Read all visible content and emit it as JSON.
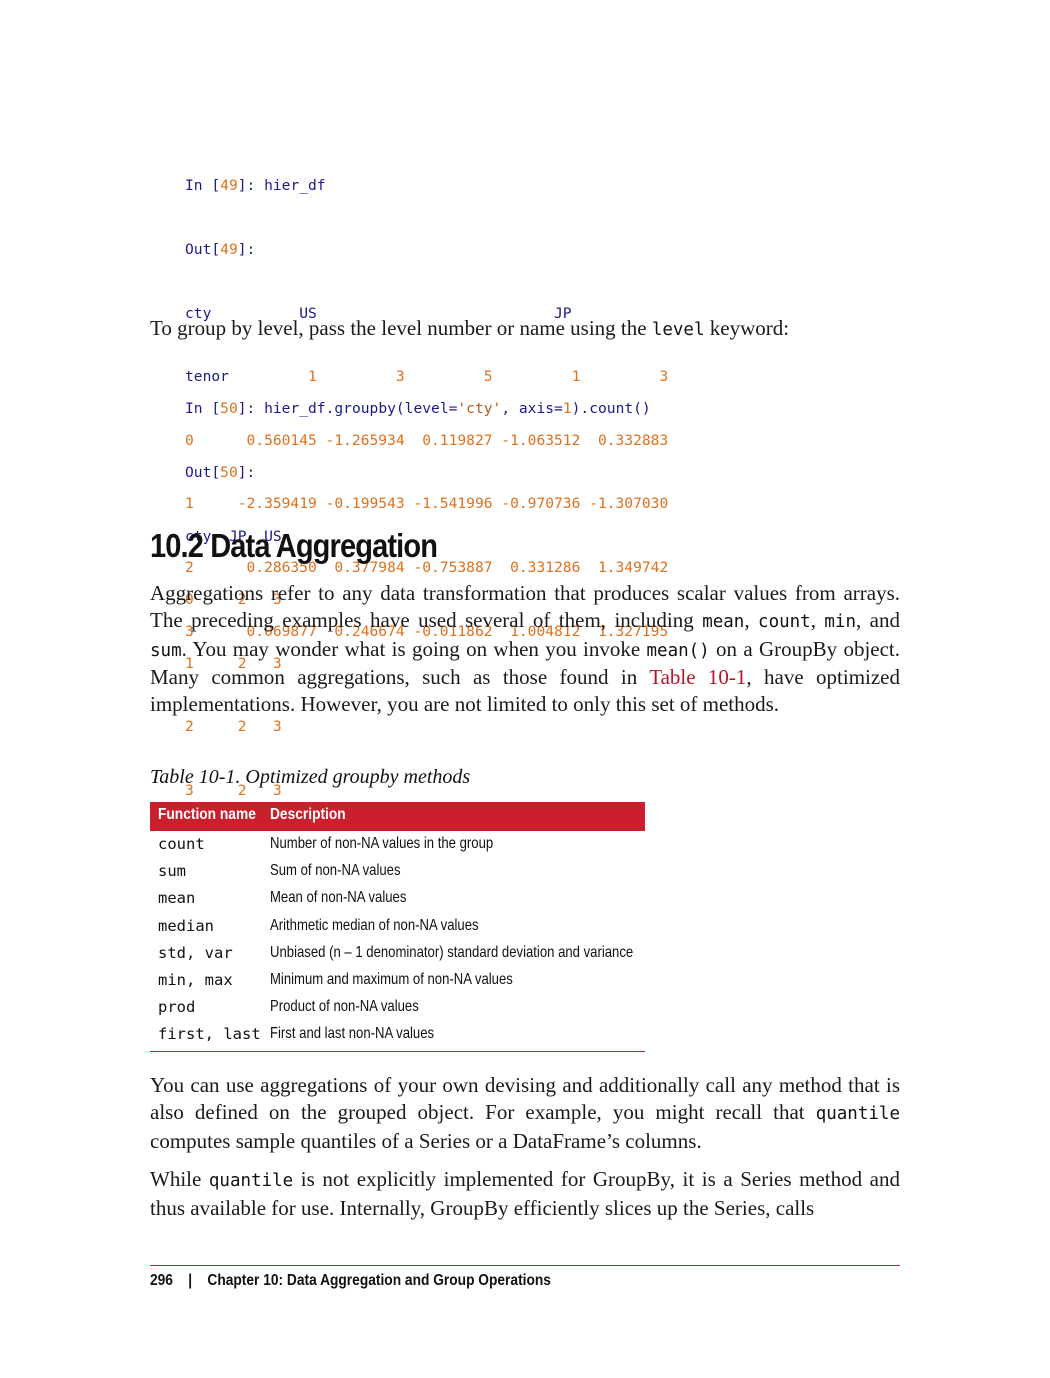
{
  "code1": {
    "in_prompt": "In [",
    "in_num": "49",
    "in_close": "]: ",
    "in_code": "hier_df",
    "out_prompt": "Out[",
    "out_num": "49",
    "out_close": "]:",
    "header_row1_label": "cty",
    "header_row1_rest": "          US                           JP",
    "header_row2_label": "tenor",
    "header_row2_rest": "         1         3         5         1         3",
    "rows": [
      "0      0.560145 -1.265934  0.119827 -1.063512  0.332883",
      "1     -2.359419 -0.199543 -1.541996 -0.970736 -1.307030",
      "2      0.286350  0.377984 -0.753887  0.331286  1.349742",
      "3      0.069877  0.246674 -0.011862  1.004812  1.327195"
    ]
  },
  "para1": {
    "before": "To group by level, pass the level number or name using the ",
    "code": "level",
    "after": " keyword:"
  },
  "code2": {
    "in_prompt": "In [",
    "in_num": "50",
    "in_close": "]: ",
    "code_a": "hier_df.groupby(level=",
    "code_str": "'cty'",
    "code_b": ", axis=",
    "code_num": "1",
    "code_c": ").count()",
    "out_prompt": "Out[",
    "out_num": "50",
    "out_close": "]:",
    "header": "cty  JP  US",
    "rows": [
      "0     2   3",
      "1     2   3",
      "2     2   3",
      "3     2   3"
    ]
  },
  "section_heading": "10.2 Data Aggregation",
  "para2": {
    "t1": "Aggregations refer to any data transformation that produces scalar values from arrays. The preceding examples have used several of them, including ",
    "c1": "mean",
    "t2": ", ",
    "c2": "count",
    "t3": ", ",
    "c3": "min",
    "t4": ", and ",
    "c4": "sum",
    "t5": ". You may wonder what is going on when you invoke ",
    "c5": "mean()",
    "t6": " on a GroupBy object. Many common aggregations, such as those found in ",
    "link": "Table 10-1",
    "t7": ", have optimized implementations. However, you are not limited to only this set of methods."
  },
  "table_caption": "Table 10-1. Optimized groupby methods",
  "table": {
    "col1": "Function name",
    "col2": "Description",
    "rows": [
      {
        "fn": "count",
        "desc": "Number of non-NA values in the group"
      },
      {
        "fn": "sum",
        "desc": "Sum of non-NA values"
      },
      {
        "fn": "mean",
        "desc": "Mean of non-NA values"
      },
      {
        "fn": "median",
        "desc": "Arithmetic median of non-NA values"
      },
      {
        "fn": "std, var",
        "desc": "Unbiased (n – 1 denominator) standard deviation and variance"
      },
      {
        "fn": "min, max",
        "desc": "Minimum and maximum of non-NA values"
      },
      {
        "fn": "prod",
        "desc": "Product of non-NA values"
      },
      {
        "fn": "first, last",
        "desc": "First and last non-NA values"
      }
    ]
  },
  "para3": {
    "t1": "You can use aggregations of your own devising and additionally call any method that is also defined on the grouped object. For example, you might recall that ",
    "c1": "quantile",
    "t2": " computes sample quantiles of a Series or a DataFrame’s columns."
  },
  "para4": {
    "t1": "While ",
    "c1": "quantile",
    "t2": " is not explicitly implemented for GroupBy, it is a Series method and thus available for use. Internally, GroupBy efficiently slices up the Series, calls"
  },
  "footer": {
    "page_number": "296",
    "separator": "|",
    "chapter": "Chapter 10: Data Aggregation and Group Operations"
  }
}
